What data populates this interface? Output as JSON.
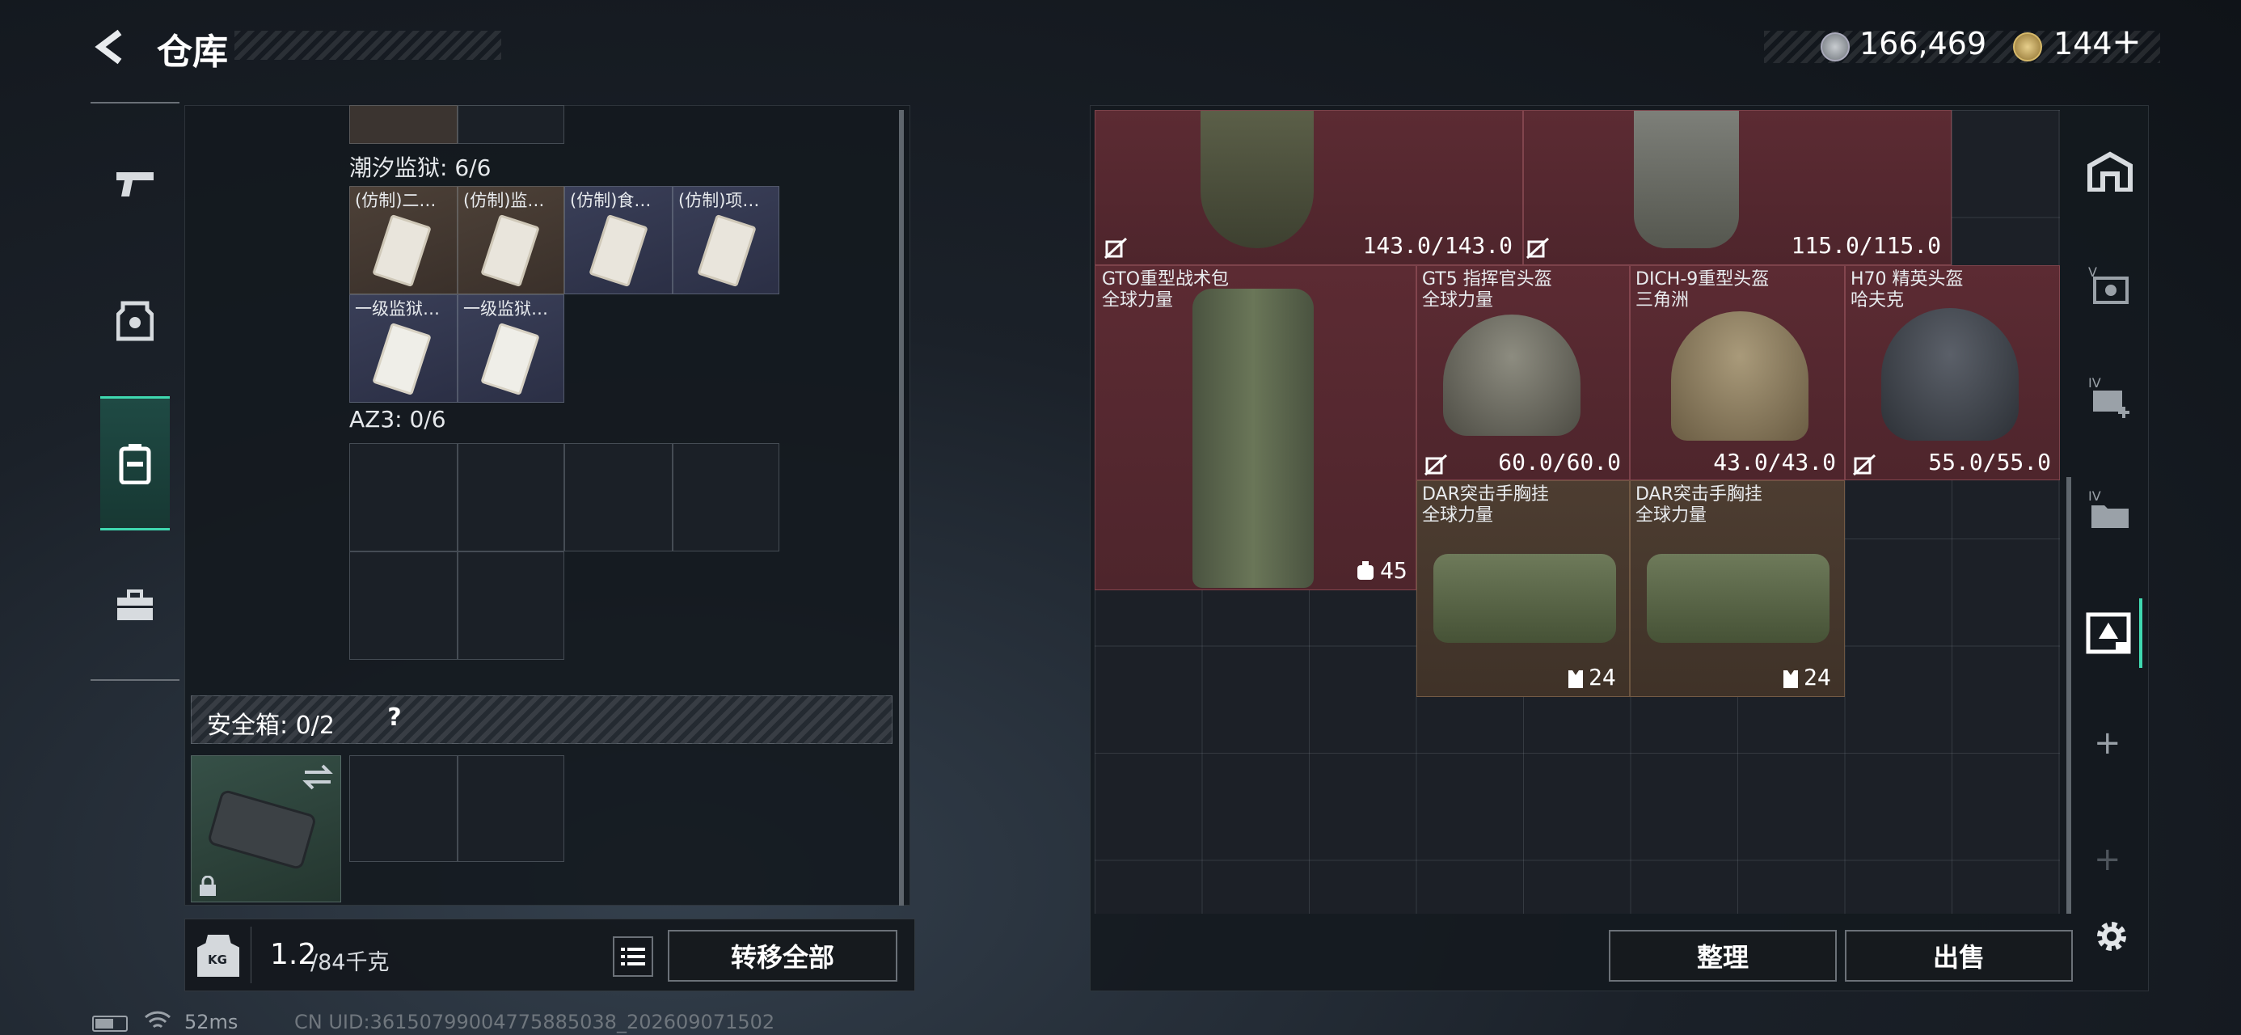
{
  "header": {
    "title": "仓库",
    "currency": "166,469",
    "premium": "144",
    "plus": "+"
  },
  "left_nav": {
    "items": [
      "weapon",
      "armor",
      "backpack",
      "case"
    ]
  },
  "stash": {
    "section1": {
      "label": "潮汐监狱: 6/6",
      "items": [
        "(仿制)二…",
        "(仿制)监…",
        "(仿制)食…",
        "(仿制)项…",
        "一级监狱…",
        "一级监狱…"
      ]
    },
    "section2": {
      "label": "AZ3: 0/6"
    },
    "safe": {
      "label": "安全箱: 0/2",
      "help": "?"
    }
  },
  "weight": {
    "value": "1.2",
    "cap": "/84千克",
    "unit": "KG"
  },
  "transfer_all": "转移全部",
  "inventory": {
    "top_left_durability": "143.0/143.0",
    "top_right_durability": "115.0/115.0",
    "items": [
      {
        "name": "GTO重型战术包",
        "sub": "全球力量",
        "stat": "45"
      },
      {
        "name": "GT5 指挥官头盔",
        "sub": "全球力量",
        "stat": "60.0/60.0"
      },
      {
        "name": "DICH-9重型头盔",
        "sub": "三角洲",
        "stat": "43.0/43.0"
      },
      {
        "name": "H70 精英头盔",
        "sub": "哈夫克",
        "stat": "55.0/55.0"
      },
      {
        "name": "DAR突击手胸挂",
        "sub": "全球力量",
        "stat": "24"
      },
      {
        "name": "DAR突击手胸挂",
        "sub": "全球力量",
        "stat": "24"
      }
    ]
  },
  "actions": {
    "sort": "整理",
    "sell": "出售"
  },
  "right_nav": {
    "add1": "+",
    "add2": "+"
  },
  "status": {
    "ping": "52ms",
    "uid": "CN UID:36150799004775885038_202609071502"
  },
  "colors": {
    "item_red": "#5a2a31",
    "item_brown": "#4a3a2e",
    "accent": "#3fd8b0"
  }
}
